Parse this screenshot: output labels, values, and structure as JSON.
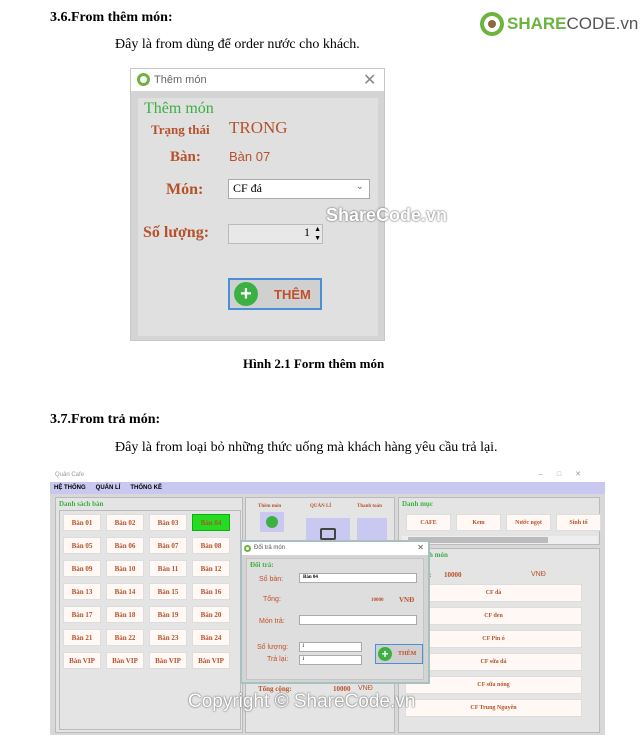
{
  "logo": {
    "text_share": "SHARE",
    "text_code": "CODE.vn",
    "brand_color": "#6db33f"
  },
  "sec1": {
    "heading": "3.6.From thêm món:",
    "paragraph": "Đây là from dùng để order nước cho khách.",
    "caption": "Hình 2.1 Form thêm món"
  },
  "form1": {
    "title": "Thêm món",
    "group_title": "Thêm món",
    "status_label": "Trạng thái",
    "status_value": "TRONG",
    "table_label": "Bàn:",
    "table_value": "Bàn 07",
    "item_label": "Món:",
    "item_value": "CF đá",
    "qty_label": "Số lượng:",
    "qty_value": "1",
    "add_button": "THÊM"
  },
  "watermark1": "ShareCode.vn",
  "sec2": {
    "heading": "3.7.From trả món:",
    "paragraph": "Đây là from loại bỏ những thức uống mà khách hàng yêu cầu trả lại."
  },
  "app": {
    "title": "Quản Cafe",
    "menu": [
      "HỆ THỐNG",
      "QUẢN LÍ",
      "THỐNG KÊ"
    ],
    "tables_title": "Danh sách bàn",
    "tables": [
      "Bàn 01",
      "Bàn 02",
      "Bàn 03",
      "Bàn 04",
      "Bàn 05",
      "Bàn 06",
      "Bàn 07",
      "Bàn 08",
      "Bàn 09",
      "Bàn 10",
      "Bàn 11",
      "Bàn 12",
      "Bàn 13",
      "Bàn 14",
      "Bàn 15",
      "Bàn 16",
      "Bàn 17",
      "Bàn 18",
      "Bàn 19",
      "Bàn 20",
      "Bàn 21",
      "Bàn 22",
      "Bàn 23",
      "Bàn 24",
      "Bàn VIP",
      "Bàn VIP",
      "Bàn VIP",
      "Bàn VIP"
    ],
    "selected_table": "Bàn 04",
    "selected_color": "#22dd22",
    "actions": [
      "Thêm món",
      "QUẢN LÍ",
      "Thanh toán"
    ],
    "category_title": "Danh mục",
    "categories": [
      "CAFE",
      "Kem",
      "Nước ngọt",
      "Sinh tố"
    ],
    "items_title": "h món",
    "total_partial_label": ":",
    "total_value": "10000",
    "currency": "VNĐ",
    "items": [
      "CF đá",
      "CF đen",
      "CF Pin ó",
      "CF sữa đá",
      "CF sữa nóng",
      "CF Trung Nguyên"
    ],
    "grand_total_label": "Tổng cộng:",
    "grand_total_value": "10000",
    "grand_currency": "VNĐ"
  },
  "dialog": {
    "title": "Đổi trả món",
    "group": "Đổi trả:",
    "table_label": "Số bàn:",
    "table_value": "Bàn 04",
    "total_label": "Tổng:",
    "total_value": "10000",
    "currency": "VNĐ",
    "item_label": "Món trả:",
    "item_value": "",
    "qty_label": "Số lượng:",
    "qty_value": "1",
    "return_label": "Trả lại:",
    "return_value": "1",
    "add_button": "THÊM"
  },
  "watermark2": "Copyright © ShareCode.vn"
}
